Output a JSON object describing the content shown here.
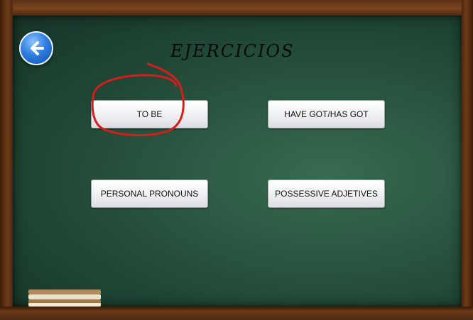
{
  "title": "EJERCICIOS",
  "back_icon": "back-arrow-icon",
  "buttons": {
    "to_be": "TO BE",
    "have_got": "HAVE GOT/HAS GOT",
    "personal_pronouns": "PERSONAL PRONOUNS",
    "possessive_adjetives": "POSSESSIVE ADJETIVES"
  },
  "colors": {
    "board": "#1f4634",
    "frame": "#6b3a18",
    "annotation": "#d81c1c",
    "back_button": "#2f7ee0"
  }
}
